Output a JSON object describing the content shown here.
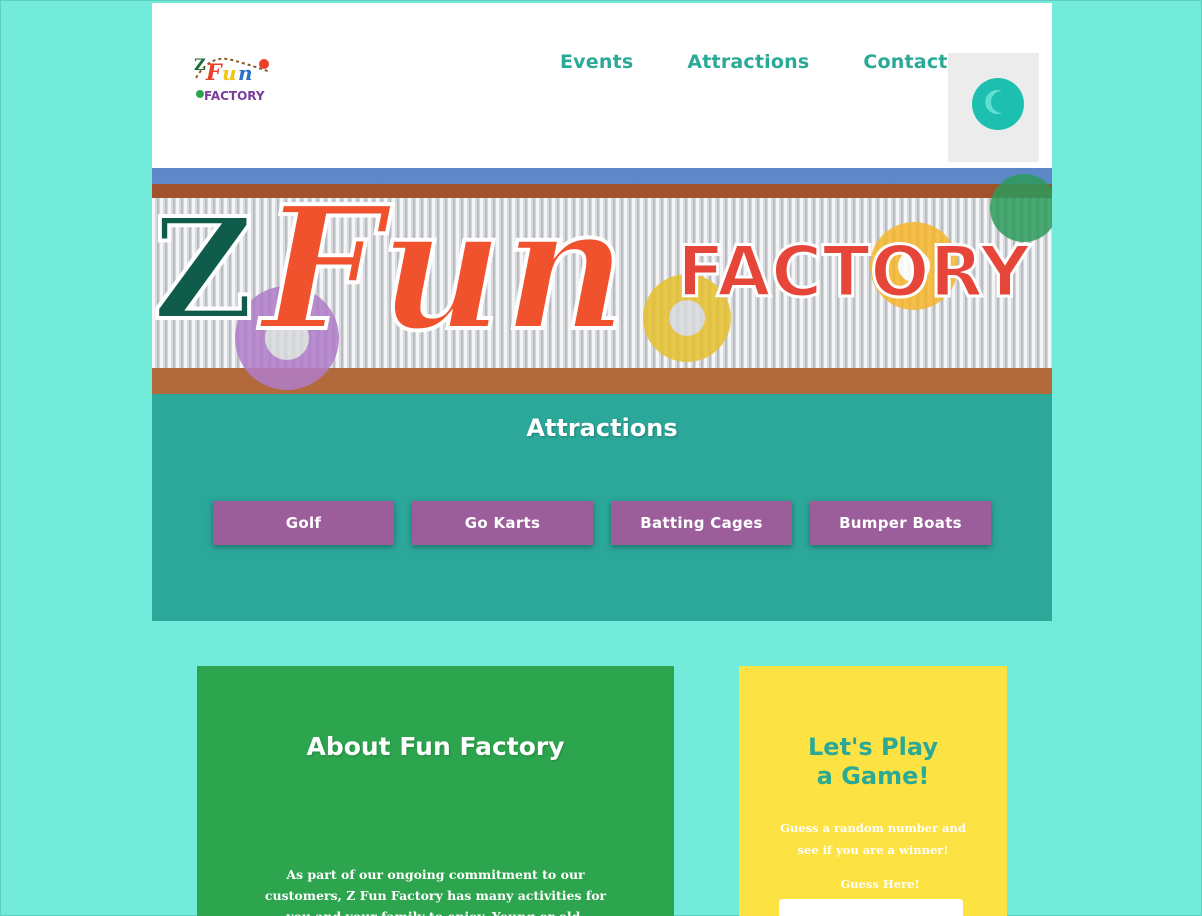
{
  "brand": {
    "logo_alt": "Z Fun Factory",
    "logo_text": [
      "Z",
      "Fun",
      "FACTORY"
    ]
  },
  "nav": {
    "items": [
      "Events",
      "Attractions",
      "Contact"
    ]
  },
  "theme_toggle": {
    "icon": "moon-icon"
  },
  "hero": {
    "sign_text": {
      "z": "Z",
      "fun": "Fun",
      "factory": "FACTORY"
    }
  },
  "attractions": {
    "title": "Attractions",
    "buttons": [
      "Golf",
      "Go Karts",
      "Batting Cages",
      "Bumper Boats"
    ]
  },
  "about": {
    "title": "About Fun Factory",
    "body": "As part of our ongoing commitment to our customers, Z Fun Factory has many activities for you and your family to enjoy. Young or old, couples or friends... our"
  },
  "game": {
    "title_line1": "Let's Play",
    "title_line2": "a Game!",
    "description": "Guess a random number and see if you are a winner!",
    "guess_label": "Guess Here!",
    "input_value": ""
  },
  "colors": {
    "background": "#72ebdb",
    "teal": "#2ba89a",
    "nav_text": "#2aa997",
    "button": "#9b5e9b",
    "green_card": "#2da54e",
    "yellow_card": "#fde243"
  }
}
